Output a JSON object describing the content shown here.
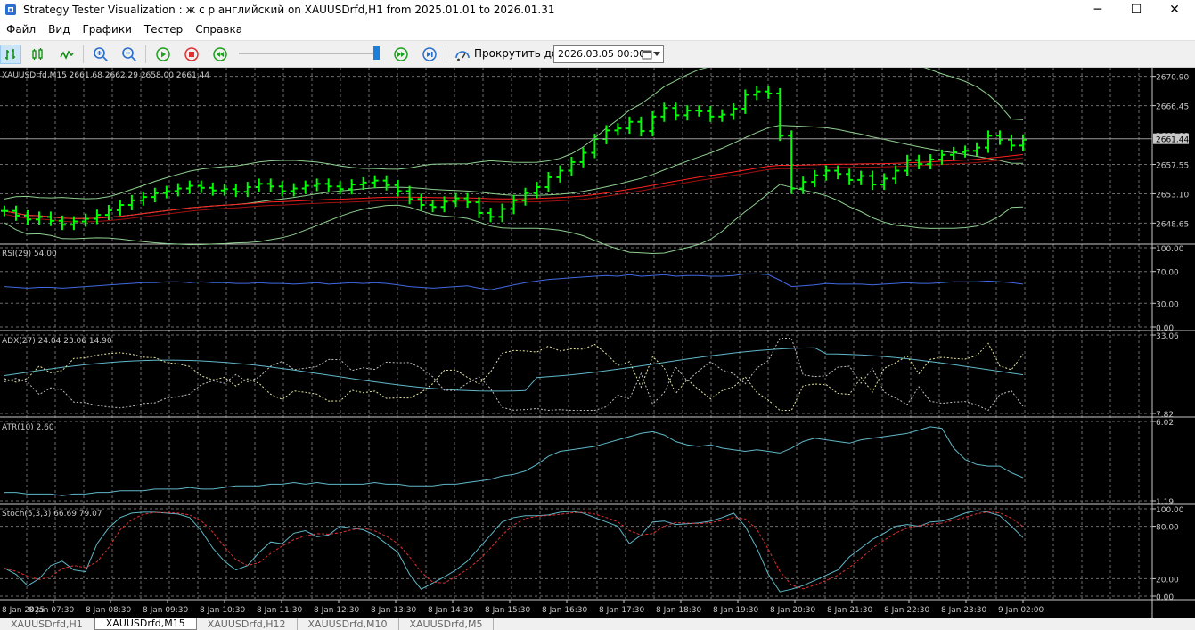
{
  "window": {
    "title": "Strategy Tester Visualization : ж с р английский on XAUUSDrfd,H1 from 2025.01.01 to 2026.01.31",
    "minimize": "─",
    "maximize": "☐",
    "close": "✕"
  },
  "menu": [
    "Файл",
    "Вид",
    "Графики",
    "Тестер",
    "Справка"
  ],
  "toolbar": {
    "scroll_label": "Прокрутить до",
    "scroll_date": "2026.03.05 00:00"
  },
  "main_chart": {
    "label": "XAUUSDrfd,M15  2661.68 2662.29 2658.00 2661.44",
    "price_levels": [
      "2670.90",
      "2666.45",
      "2662.00",
      "2657.55",
      "2653.10",
      "2648.65"
    ],
    "current_price": "2661.44",
    "colors": {
      "bars": "#00ff00",
      "ma": "#ff2020",
      "bands": "#8fd08f",
      "grid": "#6b6b6b"
    }
  },
  "rsi": {
    "label": "RSI(29) 54.00",
    "levels": [
      "100.00",
      "70.00",
      "30.00",
      "0.00"
    ],
    "color": "#4169e1"
  },
  "adx": {
    "label": "ADX(27) 24.04 23.06 14.90",
    "levels": [
      "33.06",
      "7.82"
    ]
  },
  "atr": {
    "label": "ATR(10) 2.60",
    "levels": [
      "6.02",
      "1.19"
    ]
  },
  "stoch": {
    "label": "Stoch(5,3,3) 66.69 79.07",
    "levels": [
      "100.00",
      "80.00",
      "20.00",
      "0.00"
    ]
  },
  "time_axis": [
    "8 Jan 2025",
    "8 Jan 07:30",
    "8 Jan 08:30",
    "8 Jan 09:30",
    "8 Jan 10:30",
    "8 Jan 11:30",
    "8 Jan 12:30",
    "8 Jan 13:30",
    "8 Jan 14:30",
    "8 Jan 15:30",
    "8 Jan 16:30",
    "8 Jan 17:30",
    "8 Jan 18:30",
    "8 Jan 19:30",
    "8 Jan 20:30",
    "8 Jan 21:30",
    "8 Jan 22:30",
    "8 Jan 23:30",
    "9 Jan 02:00"
  ],
  "tabs": [
    "XAUUSDrfd,H1",
    "XAUUSDrfd,M15",
    "XAUUSDrfd,H12",
    "XAUUSDrfd,M10",
    "XAUUSDrfd,M5"
  ],
  "active_tab": 1,
  "chart_data": {
    "type": "line",
    "title": "",
    "series_ohlc_close": [
      2650.5,
      2649.8,
      2649.2,
      2649.6,
      2649.0,
      2648.4,
      2648.9,
      2649.3,
      2649.9,
      2650.6,
      2651.4,
      2652.1,
      2652.6,
      2653.2,
      2653.5,
      2653.9,
      2654.3,
      2654.0,
      2653.6,
      2653.8,
      2653.4,
      2654.1,
      2654.6,
      2654.2,
      2653.5,
      2653.9,
      2654.3,
      2654.6,
      2654.2,
      2653.8,
      2654.5,
      2654.8,
      2655.1,
      2654.4,
      2653.5,
      2652.3,
      2651.4,
      2651.1,
      2651.9,
      2652.4,
      2651.8,
      2650.2,
      2649.6,
      2650.8,
      2652.1,
      2653.2,
      2654.1,
      2655.6,
      2656.6,
      2657.9,
      2659.3,
      2661.4,
      2662.7,
      2663.0,
      2664.0,
      2662.6,
      2664.8,
      2666.1,
      2665.0,
      2665.7,
      2665.6,
      2664.8,
      2665.1,
      2666.0,
      2668.1,
      2668.6,
      2668.3,
      2661.9,
      2653.9,
      2654.9,
      2655.9,
      2656.6,
      2656.1,
      2655.2,
      2655.8,
      2654.5,
      2655.4,
      2656.6,
      2658.2,
      2657.6,
      2658.3,
      2659.0,
      2659.4,
      2659.6,
      2660.1,
      2661.9,
      2661.3,
      2660.4,
      2661.3
    ],
    "rsi": [
      51,
      50,
      49,
      50,
      50,
      49,
      50,
      51,
      52,
      53,
      54,
      55,
      56,
      56,
      57,
      57,
      56,
      57,
      56,
      56,
      55,
      55,
      56,
      55,
      55,
      54,
      55,
      56,
      54,
      55,
      56,
      55,
      56,
      55,
      53,
      51,
      50,
      49,
      50,
      51,
      52,
      49,
      47,
      50,
      53,
      56,
      58,
      60,
      61,
      62,
      63,
      64,
      65,
      64,
      66,
      64,
      65,
      66,
      64,
      65,
      65,
      64,
      64,
      65,
      67,
      67,
      66,
      59,
      51,
      52,
      53,
      55,
      54,
      54,
      54,
      53,
      54,
      55,
      56,
      55,
      55,
      56,
      57,
      57,
      57,
      58,
      57,
      56,
      54
    ],
    "atr": [
      1.7,
      1.7,
      1.6,
      1.6,
      1.6,
      1.5,
      1.6,
      1.6,
      1.7,
      1.7,
      1.8,
      1.8,
      1.8,
      1.9,
      1.9,
      1.9,
      2.0,
      1.9,
      1.9,
      2.0,
      2.1,
      2.1,
      2.1,
      2.2,
      2.2,
      2.3,
      2.2,
      2.3,
      2.2,
      2.2,
      2.2,
      2.2,
      2.3,
      2.2,
      2.2,
      2.1,
      2.1,
      2.1,
      2.2,
      2.2,
      2.3,
      2.4,
      2.5,
      2.7,
      2.8,
      3.0,
      3.4,
      3.9,
      4.2,
      4.3,
      4.4,
      4.5,
      4.7,
      4.9,
      5.1,
      5.3,
      5.4,
      5.2,
      4.8,
      4.6,
      4.5,
      4.6,
      4.4,
      4.3,
      4.2,
      4.3,
      4.2,
      4.1,
      4.4,
      4.8,
      5.0,
      4.9,
      4.8,
      4.7,
      4.9,
      5.0,
      5.1,
      5.2,
      5.3,
      5.5,
      5.7,
      5.6,
      4.4,
      3.7,
      3.4,
      3.3,
      3.3,
      2.9,
      2.6
    ],
    "stoch_main": [
      32,
      25,
      12,
      20,
      35,
      40,
      30,
      28,
      60,
      78,
      90,
      95,
      96,
      96,
      95,
      94,
      90,
      75,
      55,
      40,
      30,
      35,
      50,
      62,
      60,
      72,
      75,
      68,
      70,
      80,
      78,
      76,
      70,
      60,
      50,
      25,
      8,
      15,
      22,
      30,
      40,
      55,
      70,
      85,
      90,
      92,
      92,
      93,
      96,
      97,
      95,
      90,
      85,
      80,
      60,
      70,
      85,
      86,
      82,
      83,
      84,
      86,
      90,
      95,
      80,
      55,
      25,
      5,
      8,
      12,
      18,
      24,
      30,
      45,
      55,
      65,
      72,
      80,
      82,
      80,
      85,
      86,
      90,
      95,
      98,
      96,
      92,
      80,
      67
    ]
  }
}
